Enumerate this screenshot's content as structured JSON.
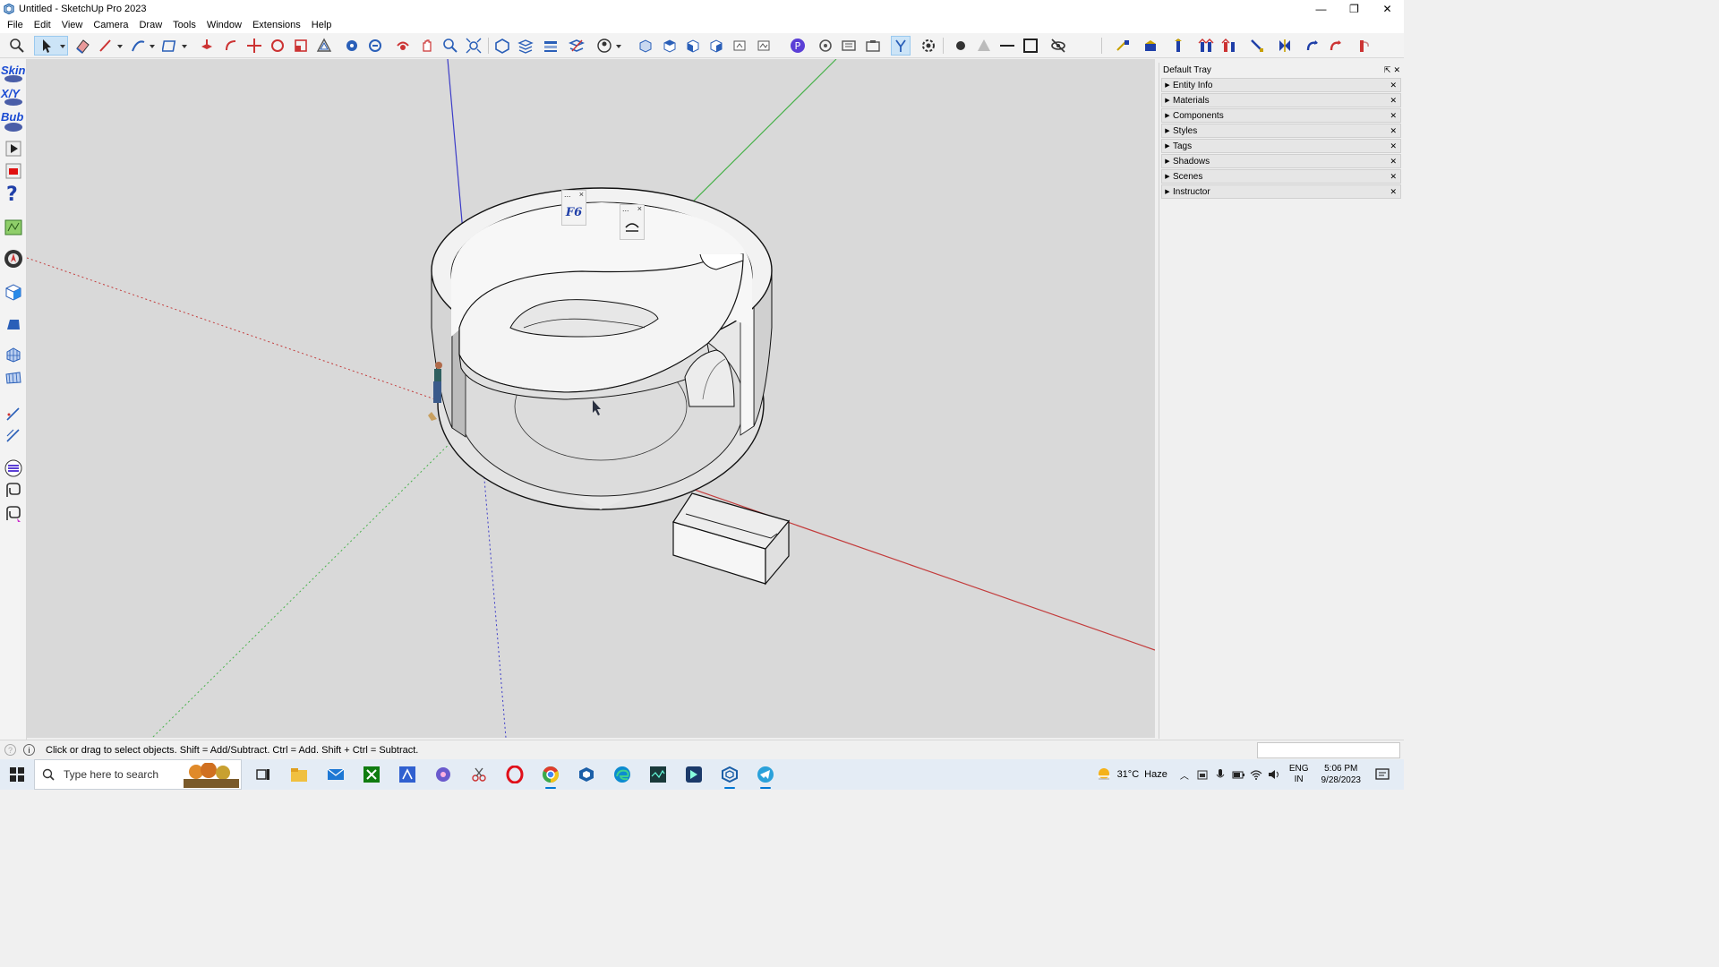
{
  "window": {
    "title": "Untitled - SketchUp Pro 2023",
    "minimize": "—",
    "restore": "❐",
    "close": "✕"
  },
  "menu": [
    "File",
    "Edit",
    "View",
    "Camera",
    "Draw",
    "Tools",
    "Window",
    "Extensions",
    "Help"
  ],
  "left_toolbar": {
    "skin_label": "Skin",
    "xy_label": "X/Y",
    "bub_label": "Bub"
  },
  "floating_toolbars": {
    "first_ellipsis": "...",
    "first_close": "×",
    "first_glyph": "F6",
    "second_ellipsis": "...",
    "second_close": "×"
  },
  "tray": {
    "title": "Default Tray",
    "pin": "⇱",
    "close": "✕",
    "panels": [
      "Entity Info",
      "Materials",
      "Components",
      "Styles",
      "Tags",
      "Shadows",
      "Scenes",
      "Instructor"
    ]
  },
  "status": {
    "message": "Click or drag to select objects. Shift = Add/Subtract. Ctrl = Add. Shift + Ctrl = Subtract.",
    "info_icon": "i",
    "geo_icon": "?"
  },
  "taskbar": {
    "search_placeholder": "Type here to search",
    "weather_temp": "31°C",
    "weather_desc": "Haze",
    "lang_top": "ENG",
    "lang_bottom": "IN",
    "time": "5:06 PM",
    "date": "9/28/2023"
  },
  "colors": {
    "axis_red": "#c33c3c",
    "axis_green": "#49b24c",
    "axis_blue": "#3c3cc8",
    "viewport_bg": "#d9d9d9",
    "accent": "#0078d4"
  }
}
